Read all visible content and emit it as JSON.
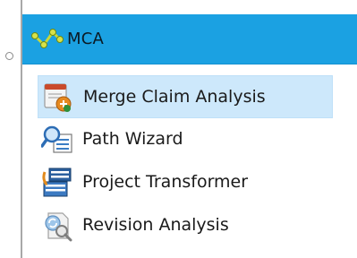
{
  "header": {
    "title": "MCA",
    "icon": "mca-logo-icon",
    "background": "#1ba1e2"
  },
  "menu": {
    "items": [
      {
        "label": "Merge Claim Analysis",
        "icon": "merge-claim-analysis-icon",
        "selected": true
      },
      {
        "label": "Path Wizard",
        "icon": "path-wizard-icon",
        "selected": false
      },
      {
        "label": "Project Transformer",
        "icon": "project-transformer-icon",
        "selected": false
      },
      {
        "label": "Revision Analysis",
        "icon": "revision-analysis-icon",
        "selected": false
      }
    ],
    "selected_background": "#cde8fb"
  }
}
